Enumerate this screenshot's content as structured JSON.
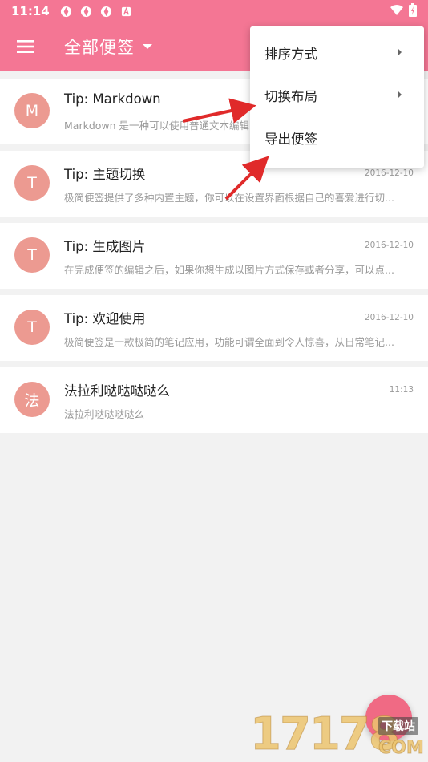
{
  "status_bar": {
    "time": "11:14",
    "icons": [
      "notification-icon",
      "notification-icon",
      "notification-icon",
      "app-a-icon",
      "wifi-icon",
      "battery-icon"
    ]
  },
  "app_bar": {
    "title": "全部便签",
    "menu_icon": "hamburger-icon",
    "color": "#f47694"
  },
  "notes": [
    {
      "avatar": "M",
      "title": "Tip: Markdown",
      "snippet": "Markdown 是一种可以使用普通文本编辑",
      "date": ""
    },
    {
      "avatar": "T",
      "title": "Tip: 主题切换",
      "snippet": "极简便签提供了多种内置主题，你可以在设置界面根据自己的喜爱进行切...",
      "date": "2016-12-10"
    },
    {
      "avatar": "T",
      "title": "Tip: 生成图片",
      "snippet": "在完成便签的编辑之后，如果你想生成以图片方式保存或者分享，可以点...",
      "date": "2016-12-10"
    },
    {
      "avatar": "T",
      "title": "Tip: 欢迎使用",
      "snippet": "极简便签是一款极简的笔记应用，功能可谓全面到令人惊喜，从日常笔记...",
      "date": "2016-12-10"
    },
    {
      "avatar": "法",
      "title": "法拉利哒哒哒哒么",
      "snippet": "法拉利哒哒哒哒么",
      "date": "11:13"
    }
  ],
  "menu": {
    "items": [
      {
        "label": "排序方式",
        "has_submenu": true
      },
      {
        "label": "切换布局",
        "has_submenu": true
      },
      {
        "label": "导出便签",
        "has_submenu": false
      }
    ]
  },
  "fab": {
    "icon": "add-icon"
  },
  "watermark": {
    "digits": "17178",
    "label": "下载站",
    "domain": "COM"
  }
}
